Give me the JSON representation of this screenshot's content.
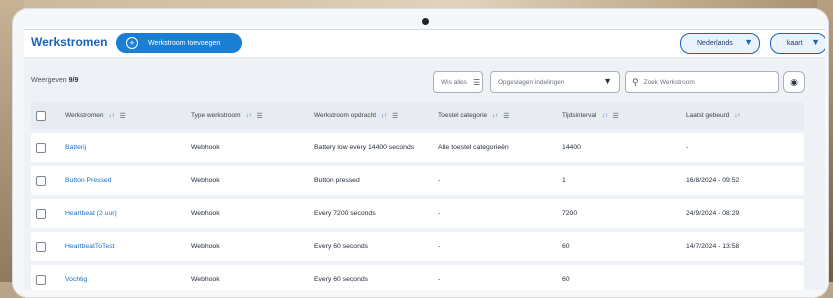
{
  "header": {
    "title": "Werkstromen",
    "add_button": "Werkstroom toevoegen",
    "language": "Nederlands",
    "map_button": "kaart"
  },
  "toolbar": {
    "count_label": "Weergeven",
    "count_value": "9/9",
    "clear_all": "Wis alles",
    "dropdown_placeholder": "Opgeslagen indelingen",
    "search_placeholder": "Zoek Werkstroom"
  },
  "table": {
    "columns": [
      "Werkstromen",
      "Type werkstroom",
      "Werkstroom opdracht",
      "Toestel categorie",
      "Tijdsinterval",
      "Laatst gebeurd"
    ],
    "rows": [
      [
        "Batterij",
        "Webhook",
        "Battery low every 14400 seconds",
        "Alle toestel categorieën",
        "14400",
        "-"
      ],
      [
        "Button Pressed",
        "Webhook",
        "Button pressed",
        "-",
        "1",
        "16/8/2024 - 09:52"
      ],
      [
        "Heartbeat (2 uur)",
        "Webhook",
        "Every 7200 seconds",
        "-",
        "7200",
        "24/9/2024 - 08:29"
      ],
      [
        "HeartbeatToTest",
        "Webhook",
        "Every 60 seconds",
        "-",
        "60",
        "14/7/2024 - 13:58"
      ],
      [
        "Vochtig",
        "Webhook",
        "Every 60 seconds",
        "-",
        "60",
        ""
      ]
    ]
  },
  "colors": {
    "brand": "#1b63b8",
    "button": "#1a7fd4",
    "link": "#1b6fc8"
  }
}
